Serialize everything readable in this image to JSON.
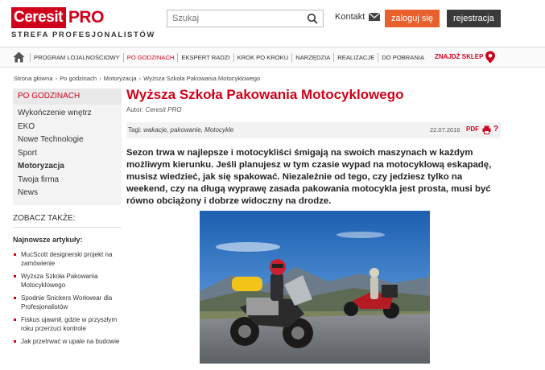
{
  "header": {
    "logo_ceresit": "Ceresit",
    "logo_pro": "PRO",
    "logo_tagline": "STREFA PROFESJONALISTÓW",
    "search_placeholder": "Szukaj",
    "contact_label": "Kontakt",
    "login_label": "zaloguj się",
    "register_label": "rejestracja"
  },
  "nav": {
    "items": [
      "PROGRAM LOJALNOŚCIOWY",
      "PO GODZINACH",
      "EKSPERT RADZI",
      "KROK PO KROKU",
      "NARZĘDZIA",
      "REALIZACJE",
      "DO POBRANIA"
    ],
    "active_index": 1,
    "store_locator": "ZNAJDŹ SKLEP"
  },
  "breadcrumb": {
    "items": [
      "Strona główna",
      "Po godzinach",
      "Motoryzacja",
      "Wyższa Szkoła Pakowania Motocyklowego"
    ]
  },
  "sidebar": {
    "heading": "PO GODZINACH",
    "items": [
      "Wykończenie wnętrz",
      "EKO",
      "Nowe Technologie",
      "Sport",
      "Motoryzacja",
      "Twoja firma",
      "News"
    ],
    "active_index": 4,
    "see_also": "ZOBACZ TAKŻE:",
    "latest_heading": "Najnowsze artykuły:",
    "latest_articles": [
      "MucScott designerski projekt na zamówienie",
      "Wyższa Szkoła Pakowania Motocyklowego",
      "Spodnie Snickers Workwear dla Profesjonalistów",
      "Fiskus ujawnił, gdzie w przyszłym roku przerzuci kontrole",
      "Jak przetrwać w upale na budowie"
    ]
  },
  "article": {
    "title": "Wyższa Szkoła Pakowania Motocyklowego",
    "author_label": "Autor:",
    "author_name": "Ceresit PRO",
    "tags_label": "Tagi:",
    "tags": "wakacje, pakowanie, Motocykle",
    "date": "22.07.2016",
    "pdf_label": "PDF",
    "help_label": "?",
    "lead": "Sezon trwa w najlepsze i motocykliści śmigają na swoich maszynach w każdym możliwym kierunku. Jeśli planujesz w tym czasie wypad na motocyklową eskapadę, musisz wiedzieć, jak się spakować. Niezależnie od tego, czy jedziesz tylko na weekend, czy na długą wyprawę zasada pakowania motocykla jest prosta, musi być równo obciążony i dobrze widoczny na drodze."
  },
  "colors": {
    "brand_red": "#d0021b",
    "login_orange": "#e8612c",
    "register_dark": "#3a3a3a"
  }
}
